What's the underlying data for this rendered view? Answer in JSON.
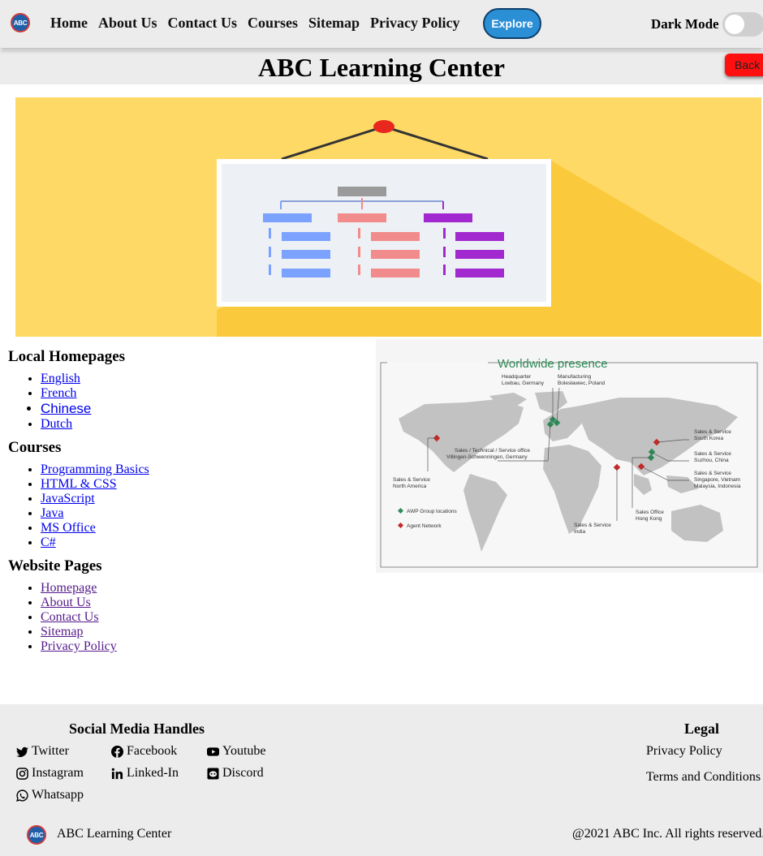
{
  "nav": {
    "logo_text": "ABC",
    "links": [
      "Home",
      "About Us",
      "Contact Us",
      "Courses",
      "Sitemap",
      "Privacy Policy"
    ],
    "explore_label": "Explore",
    "dark_mode_label": "Dark Mode",
    "dark_mode_on": false
  },
  "header": {
    "title": "ABC Learning Center",
    "back_label": "Back"
  },
  "map": {
    "title": "Worldwide presence",
    "labels": {
      "hq": "Headquarter",
      "hq_loc": "Loebau, Germany",
      "mfg": "Manufacturing",
      "mfg_loc": "Bolesławiec, Poland",
      "sales_tech": "Sales / Technical / Service office",
      "sales_tech_loc": "Villingen-Schwenningen, Germany",
      "na": "Sales & Service",
      "na_loc": "North America",
      "sk": "Sales & Service",
      "sk_loc": "South Korea",
      "cn": "Sales & Service",
      "cn_loc": "Suzhou, China",
      "sea": "Sales & Service",
      "sea_loc1": "Singapore, Vietnam",
      "sea_loc2": "Malaysia, Indonesia",
      "in": "Sales & Service",
      "in_loc": "India",
      "hk": "Sales Office",
      "hk_loc": "Hong Kong",
      "legend_awp": "AWP Group locations",
      "legend_agent": "Agent Network"
    }
  },
  "sections": {
    "local": {
      "heading": "Local Homepages",
      "items": [
        "English",
        "French",
        "Chinese",
        "Dutch"
      ]
    },
    "courses": {
      "heading": "Courses",
      "items": [
        "Programming Basics",
        "HTML & CSS",
        "JavaScript",
        "Java",
        "MS Office",
        "C#"
      ]
    },
    "pages": {
      "heading": "Website Pages",
      "items": [
        "Homepage",
        "About Us",
        "Contact Us",
        "Sitemap",
        "Privacy Policy"
      ]
    }
  },
  "footer": {
    "social_heading": "Social Media Handles",
    "social": [
      "Twitter",
      "Facebook",
      "Youtube",
      "Instagram",
      "Linked-In",
      "Discord",
      "Whatsapp"
    ],
    "legal_heading": "Legal",
    "legal": [
      "Privacy Policy",
      "Terms and Conditions"
    ],
    "brand": "ABC Learning Center",
    "copyright": "@2021 ABC Inc. All rights reserved."
  },
  "colors": {
    "hero_bg": "#ffd966",
    "hero_shadow": "#fbc93c",
    "explore": "#2b8fd6",
    "back": "#ff1010",
    "map_green": "#2e8b57",
    "map_red": "#c62828"
  },
  "icons": {
    "hero": "org-chart-illustration",
    "social": [
      "twitter-icon",
      "facebook-icon",
      "youtube-icon",
      "instagram-icon",
      "linkedin-icon",
      "discord-icon",
      "whatsapp-icon"
    ]
  }
}
